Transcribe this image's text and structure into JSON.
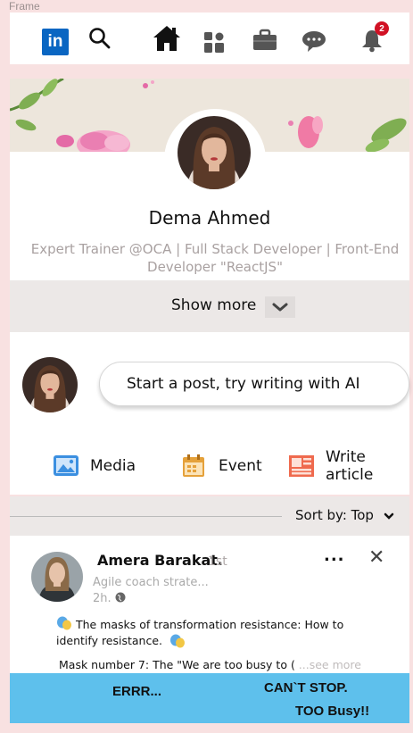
{
  "frame_label": "Frame",
  "nav": {
    "logo_text": "in",
    "notification_count": "2",
    "icons": [
      "linkedin-logo",
      "search-icon",
      "home-icon",
      "network-icon",
      "jobs-icon",
      "messaging-icon",
      "notifications-icon"
    ]
  },
  "profile": {
    "name": "Dema Ahmed",
    "headline": "Expert Trainer @OCA | Full Stack Developer | Front-End Developer \"ReactJS\"",
    "show_more": "Show more"
  },
  "compose": {
    "placeholder": "Start a post, try writing with AI",
    "actions": [
      {
        "label": "Media",
        "icon": "media-icon"
      },
      {
        "label": "Event",
        "icon": "event-icon"
      },
      {
        "label": "Write article",
        "icon": "article-icon"
      }
    ]
  },
  "feed": {
    "sort_label": "Sort by: Top"
  },
  "post": {
    "author": "Amera Barakat.",
    "degree": "1st",
    "subtitle": "Agile coach strate...",
    "time": "2h.",
    "more_label": "...",
    "line1": "The masks of transformation resistance: How to identify resistance.",
    "line2": "Mask number 7: The \"We are too busy to (",
    "see_more": " ...see more"
  },
  "bottom": {
    "text1": "ERRR...",
    "text2": "CAN`T STOP.",
    "text3": "TOO Busy!!"
  },
  "colors": {
    "page_bg": "#f8e1e1",
    "linkedin_blue": "#0a66c2",
    "badge_red": "#d11124",
    "bottom_bar": "#5ec0ec"
  }
}
